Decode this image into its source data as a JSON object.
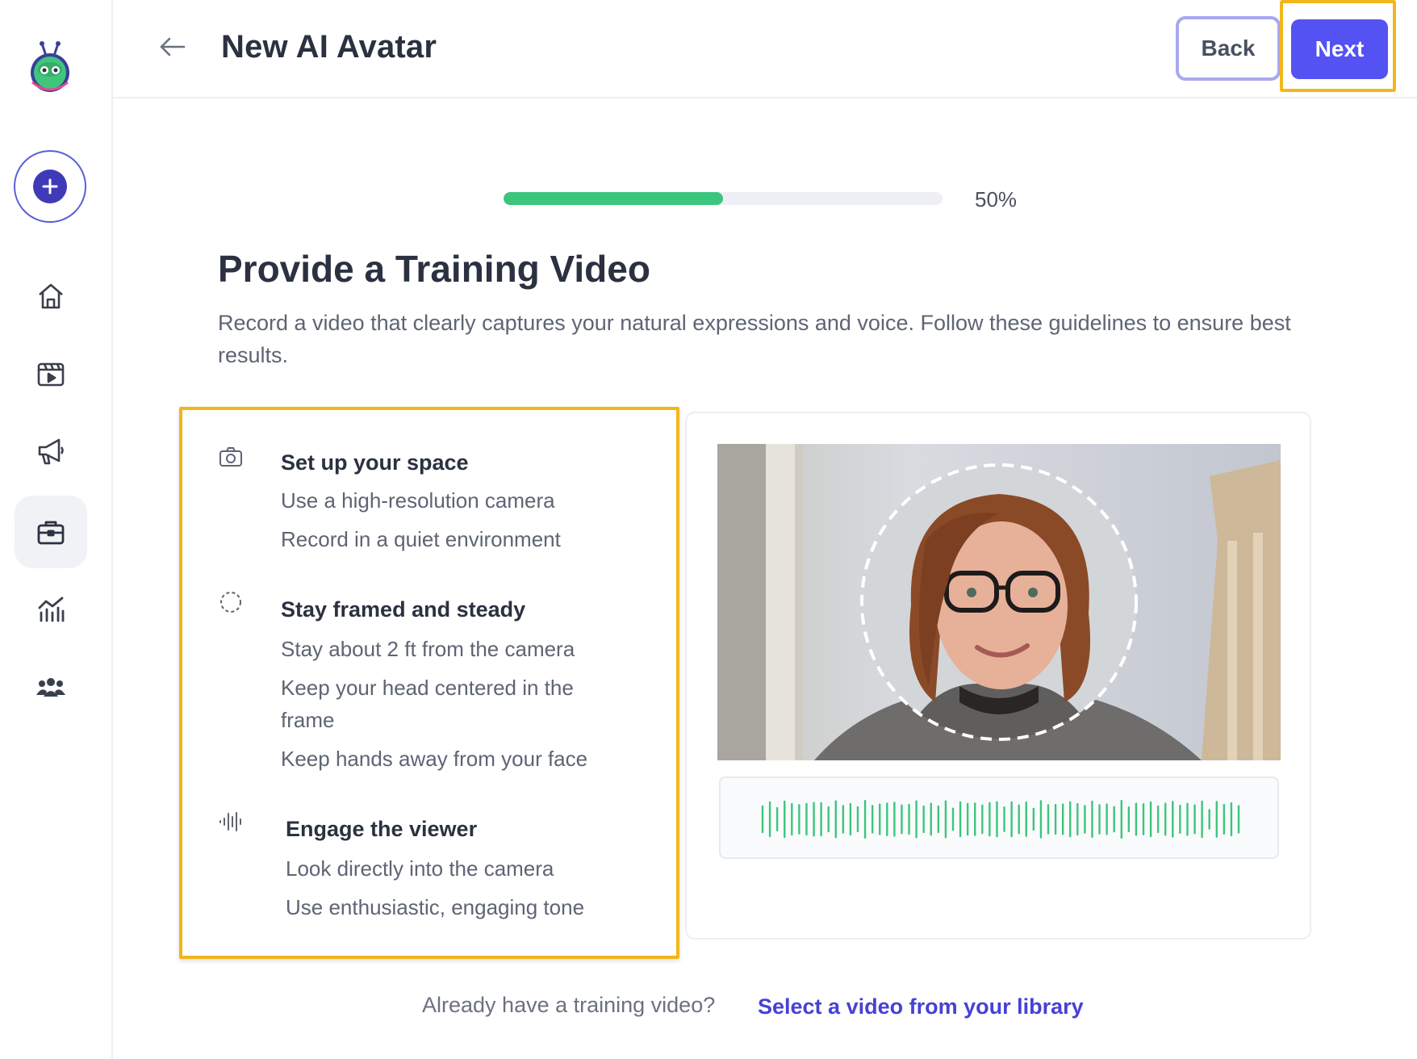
{
  "header": {
    "title": "New AI Avatar",
    "back_label": "Back",
    "next_label": "Next"
  },
  "sidebar": {
    "items": [
      {
        "name": "home",
        "icon": "home-icon"
      },
      {
        "name": "videos",
        "icon": "video-clapper-icon"
      },
      {
        "name": "campaigns",
        "icon": "megaphone-icon"
      },
      {
        "name": "avatars",
        "icon": "briefcase-icon",
        "active": true
      },
      {
        "name": "analytics",
        "icon": "chart-icon"
      },
      {
        "name": "team",
        "icon": "users-icon"
      }
    ]
  },
  "progress": {
    "value": 0.5,
    "label": "50%"
  },
  "section": {
    "title": "Provide a Training Video",
    "description": "Record a video that clearly captures your natural expressions and voice. Follow these guidelines to ensure best results."
  },
  "guidelines": [
    {
      "icon": "camera-icon",
      "title": "Set up your space",
      "items": [
        "Use a high-resolution camera",
        "Record in a quiet environment"
      ]
    },
    {
      "icon": "dashed-circle-icon",
      "title": "Stay framed and steady",
      "items": [
        "Stay about 2 ft from the camera",
        "Keep your head centered in the frame",
        "Keep hands away from your face"
      ]
    },
    {
      "icon": "waveform-icon",
      "title": "Engage the viewer",
      "items": [
        "Look directly into the camera",
        "Use enthusiastic, engaging tone"
      ]
    }
  ],
  "footer": {
    "question": "Already have a training video?",
    "link": "Select a video from your library"
  },
  "colors": {
    "accent": "#5452f2",
    "progress": "#3cc57d",
    "highlight": "#f2b61c",
    "link": "#4641d6"
  }
}
